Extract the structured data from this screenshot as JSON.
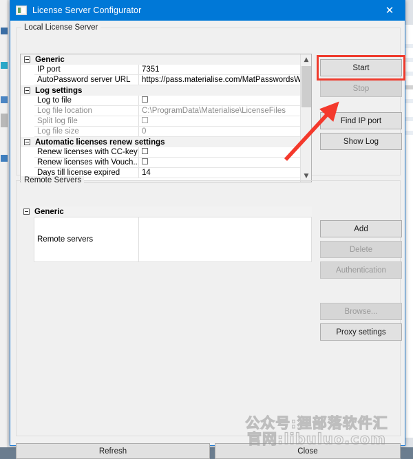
{
  "window": {
    "title": "License Server Configurator",
    "icon": "app-icon",
    "close_label": "✕"
  },
  "local_group": {
    "title": "Local License Server",
    "grid": {
      "categories": [
        {
          "label": "Generic",
          "rows": [
            {
              "name": "IP port",
              "value": "7351",
              "type": "text",
              "disabled": false
            },
            {
              "name": "AutoPassword server URL",
              "value": "https://pass.materialise.com/MatPasswordsWS/M",
              "type": "text",
              "disabled": false
            }
          ]
        },
        {
          "label": "Log settings",
          "rows": [
            {
              "name": "Log to file",
              "value": "",
              "type": "checkbox",
              "checked": false,
              "disabled": false
            },
            {
              "name": "Log file location",
              "value": "C:\\ProgramData\\Materialise\\LicenseFiles",
              "type": "text",
              "disabled": true
            },
            {
              "name": "Split log file",
              "value": "",
              "type": "checkbox",
              "checked": false,
              "disabled": true
            },
            {
              "name": "Log file size",
              "value": "0",
              "type": "text",
              "disabled": true
            }
          ]
        },
        {
          "label": "Automatic licenses renew settings",
          "rows": [
            {
              "name": "Renew licenses with CC-key",
              "value": "",
              "type": "checkbox",
              "checked": false,
              "disabled": false
            },
            {
              "name": "Renew licenses with Vouch...",
              "value": "",
              "type": "checkbox",
              "checked": false,
              "disabled": false
            },
            {
              "name": "Days till license expired",
              "value": "14",
              "type": "text",
              "disabled": false
            }
          ]
        }
      ]
    },
    "buttons": [
      {
        "label": "Start",
        "name": "start-button",
        "disabled": false,
        "highlighted": true
      },
      {
        "label": "Stop",
        "name": "stop-button",
        "disabled": true,
        "highlighted": false
      },
      {
        "label": "Find IP port",
        "name": "find-ip-port-button",
        "disabled": false,
        "highlighted": false
      },
      {
        "label": "Show Log",
        "name": "show-log-button",
        "disabled": false,
        "highlighted": false
      }
    ]
  },
  "remote_group": {
    "title": "Remote Servers",
    "category_label": "Generic",
    "row_label": "Remote servers",
    "row_value": "",
    "buttons": [
      {
        "label": "Add",
        "name": "add-button",
        "disabled": false
      },
      {
        "label": "Delete",
        "name": "delete-button",
        "disabled": true
      },
      {
        "label": "Authentication",
        "name": "authentication-button",
        "disabled": true
      },
      {
        "label": "Browse...",
        "name": "browse-button",
        "disabled": true
      },
      {
        "label": "Proxy settings",
        "name": "proxy-settings-button",
        "disabled": false
      }
    ]
  },
  "footer": {
    "refresh_label": "Refresh",
    "close_label": "Close"
  },
  "watermark": {
    "line1": "公众号:狸部落软件汇",
    "line2": "官网:libuluo.com"
  },
  "annotation": {
    "highlight_color": "#ef3b2d",
    "arrow_color": "#f4392c",
    "highlight_target": "start-button"
  },
  "colors": {
    "titlebar": "#0078d7",
    "window_bg": "#f0f0f0",
    "button_face": "#e1e1e1",
    "grid_bg": "#ffffff",
    "accent_border": "#1c7ad4"
  }
}
